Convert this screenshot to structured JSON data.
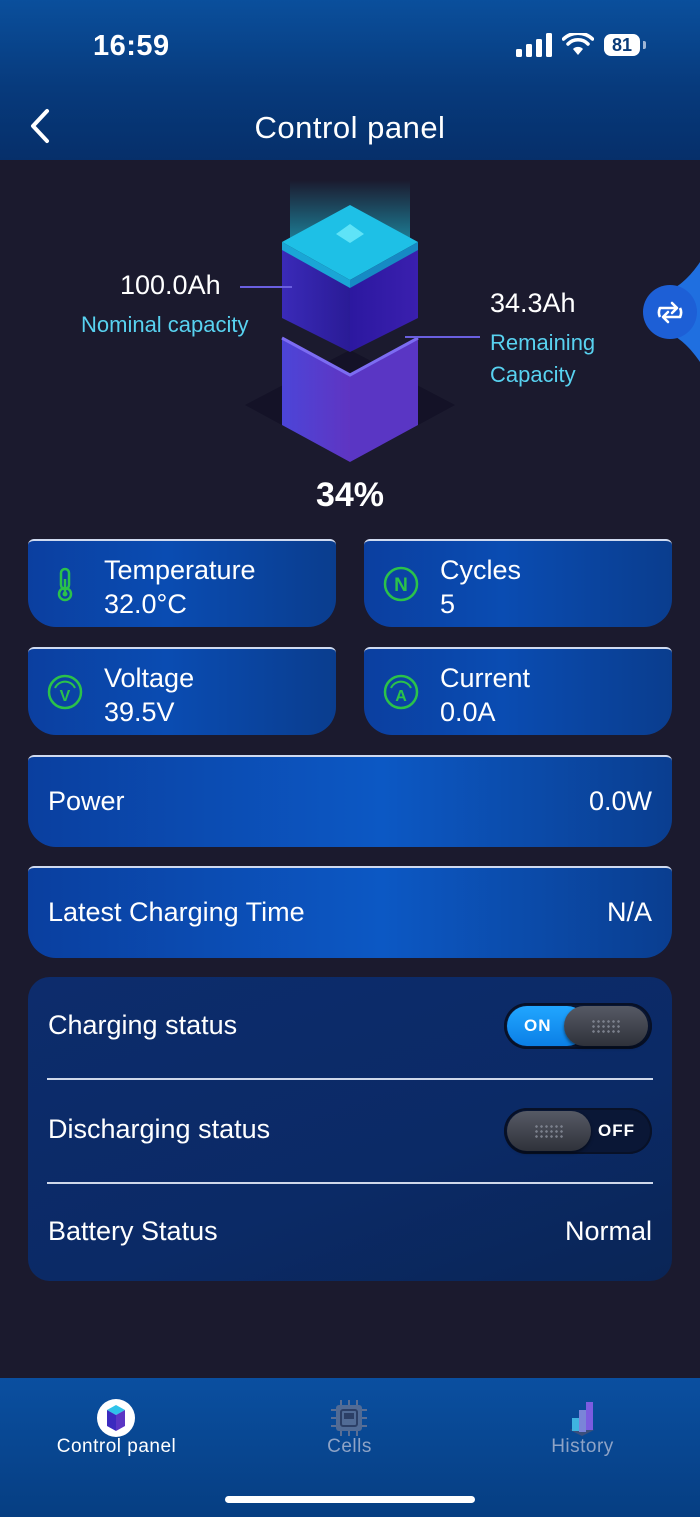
{
  "status_bar": {
    "time": "16:59",
    "battery": "81"
  },
  "header": {
    "title": "Control panel"
  },
  "battery": {
    "nominal_value": "100.0Ah",
    "nominal_label": "Nominal capacity",
    "remaining_value": "34.3Ah",
    "remaining_label_1": "Remaining",
    "remaining_label_2": "Capacity",
    "percent": "34%",
    "level_fraction": 0.34
  },
  "stats": {
    "temperature": {
      "label": "Temperature",
      "value": "32.0°C"
    },
    "cycles": {
      "label": "Cycles",
      "value": "5"
    },
    "voltage": {
      "label": "Voltage",
      "value": "39.5V"
    },
    "current": {
      "label": "Current",
      "value": "0.0A"
    }
  },
  "power": {
    "label": "Power",
    "value": "0.0W"
  },
  "charging_time": {
    "label": "Latest Charging Time",
    "value": "N/A"
  },
  "controls": {
    "charging": {
      "label": "Charging status",
      "state": "ON"
    },
    "discharging": {
      "label": "Discharging status",
      "state": "OFF"
    },
    "battery_status": {
      "label": "Battery Status",
      "value": "Normal"
    }
  },
  "tabs": [
    {
      "label": "Control panel",
      "icon": "battery-cube-icon",
      "active": true
    },
    {
      "label": "Cells",
      "icon": "chip-icon",
      "active": false
    },
    {
      "label": "History",
      "icon": "bar-chart-icon",
      "active": false
    }
  ],
  "colors": {
    "accent": "#58d2f0",
    "active_green": "#2bc24a",
    "toggle_on": "#1a9cff"
  }
}
